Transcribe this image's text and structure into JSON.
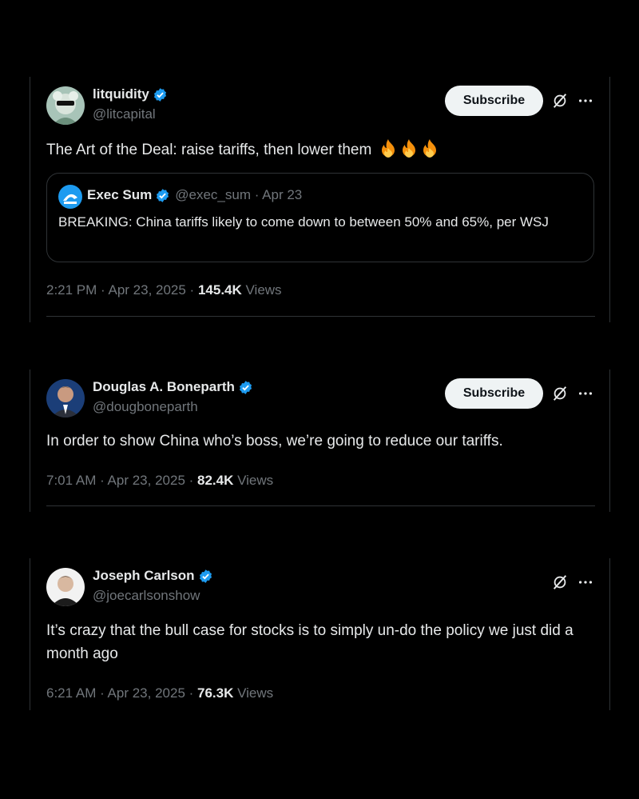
{
  "tweets": [
    {
      "name": "litquidity",
      "handle": "@litcapital",
      "subscribe_label": "Subscribe",
      "text": "The Art of the Deal: raise tariffs, then lower them",
      "emoji": [
        "fire-emoji",
        "fire-emoji",
        "fire-emoji"
      ],
      "quote": {
        "name": "Exec Sum",
        "handle": "@exec_sum · Apr 23",
        "text": "BREAKING: China tariffs likely to come down to between 50% and 65%, per WSJ"
      },
      "time": "2:21 PM · Apr 23, 2025 · ",
      "views_count": "145.4K",
      "views_label": " Views"
    },
    {
      "name": "Douglas A. Boneparth",
      "handle": "@dougboneparth",
      "subscribe_label": "Subscribe",
      "text": "In order to show China who’s boss, we’re going to reduce our tariffs.",
      "time": "7:01 AM · Apr 23, 2025 · ",
      "views_count": "82.4K",
      "views_label": " Views"
    },
    {
      "name": "Joseph Carlson",
      "handle": "@joecarlsonshow",
      "text": "It’s crazy that the bull case for stocks is to simply un-do the policy we just did a month ago",
      "time": "6:21 AM · Apr 23, 2025 · ",
      "views_count": "76.3K",
      "views_label": " Views"
    }
  ],
  "icons": {
    "verified": "verified-badge-icon",
    "grok": "grok-icon",
    "more": "more-icon"
  },
  "colors": {
    "background": "#000000",
    "text": "#e7e9ea",
    "muted": "#71767b",
    "border": "#2f3336",
    "verified": "#1d9bf0",
    "button_bg": "#eff3f4"
  }
}
